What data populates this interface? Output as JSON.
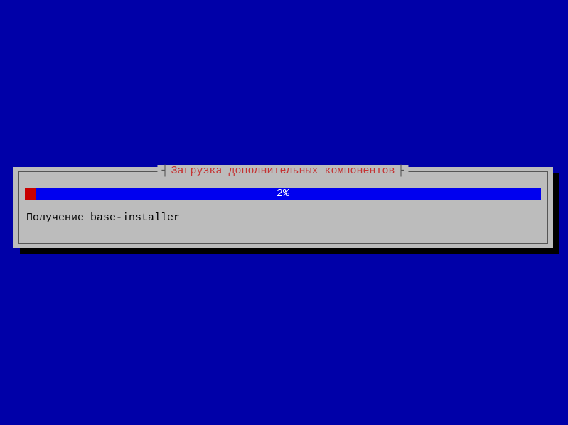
{
  "dialog": {
    "title": "Загрузка дополнительных компонентов",
    "progress": {
      "percent_label": "2%",
      "percent_value": 2
    },
    "status": "Получение base-installer"
  },
  "colors": {
    "background": "#0000a8",
    "dialog_bg": "#bcbcbc",
    "progress_bg": "#0000ef",
    "progress_fill": "#c80000",
    "title": "#c53232"
  }
}
